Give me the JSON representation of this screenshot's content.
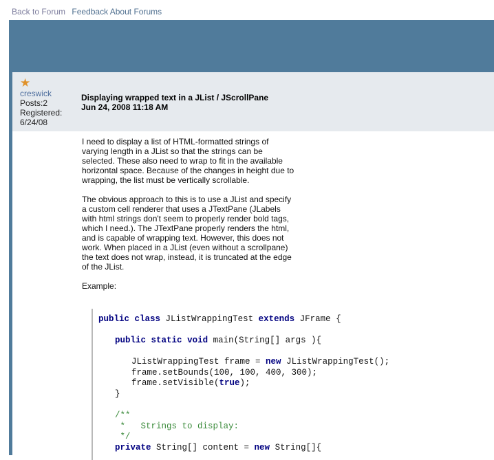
{
  "nav": {
    "back": "Back to Forum",
    "feedback": "Feedback About Forums"
  },
  "author": {
    "name": "creswick",
    "posts": "Posts:2",
    "registered_label": "Registered:",
    "registered_date": "6/24/08"
  },
  "post": {
    "subject": "Displaying wrapped text in a JList / JScrollPane",
    "date": "Jun 24, 2008 11:18 AM",
    "paragraphs": [
      "I need to display a list of HTML-formatted strings of varying length in a JList so that the strings can be selected. These also need to wrap to fit in the available horizontal space. Because of the changes in height due to wrapping, the list must be vertically scrollable.",
      "The obvious approach to this is to use a JList and specify a custom cell renderer that uses a JTextPane (JLabels with html strings don't seem to properly render bold tags, which I need.). The JTextPane properly renders the html, and is capable of wrapping text. However, this does not work. When placed in a JList (even without a scrollpane) the text does not wrap, instead, it is truncated at the edge of the JList.",
      "Example:"
    ]
  },
  "code": {
    "l1_kw1": "public",
    "l1_kw2": "class",
    "l1_name": " JListWrappingTest ",
    "l1_kw3": "extends",
    "l1_rest": " JFrame {",
    "l2_kw1": "public",
    "l2_kw2": "static",
    "l2_kw3": "void",
    "l2_rest": " main(String[] args ){",
    "l3_a": "JListWrappingTest frame = ",
    "l3_kw": "new",
    "l3_b": " JListWrappingTest();",
    "l4": "frame.setBounds(100, 100, 400, 300);",
    "l5_a": "frame.setVisible(",
    "l5_kw": "true",
    "l5_b": ");",
    "l6": "}",
    "c1": "/**",
    "c2": " *   Strings to display:",
    "c3": " */",
    "l7_kw": "private",
    "l7_a": " String[] content = ",
    "l7_kw2": "new",
    "l7_b": " String[]{"
  }
}
